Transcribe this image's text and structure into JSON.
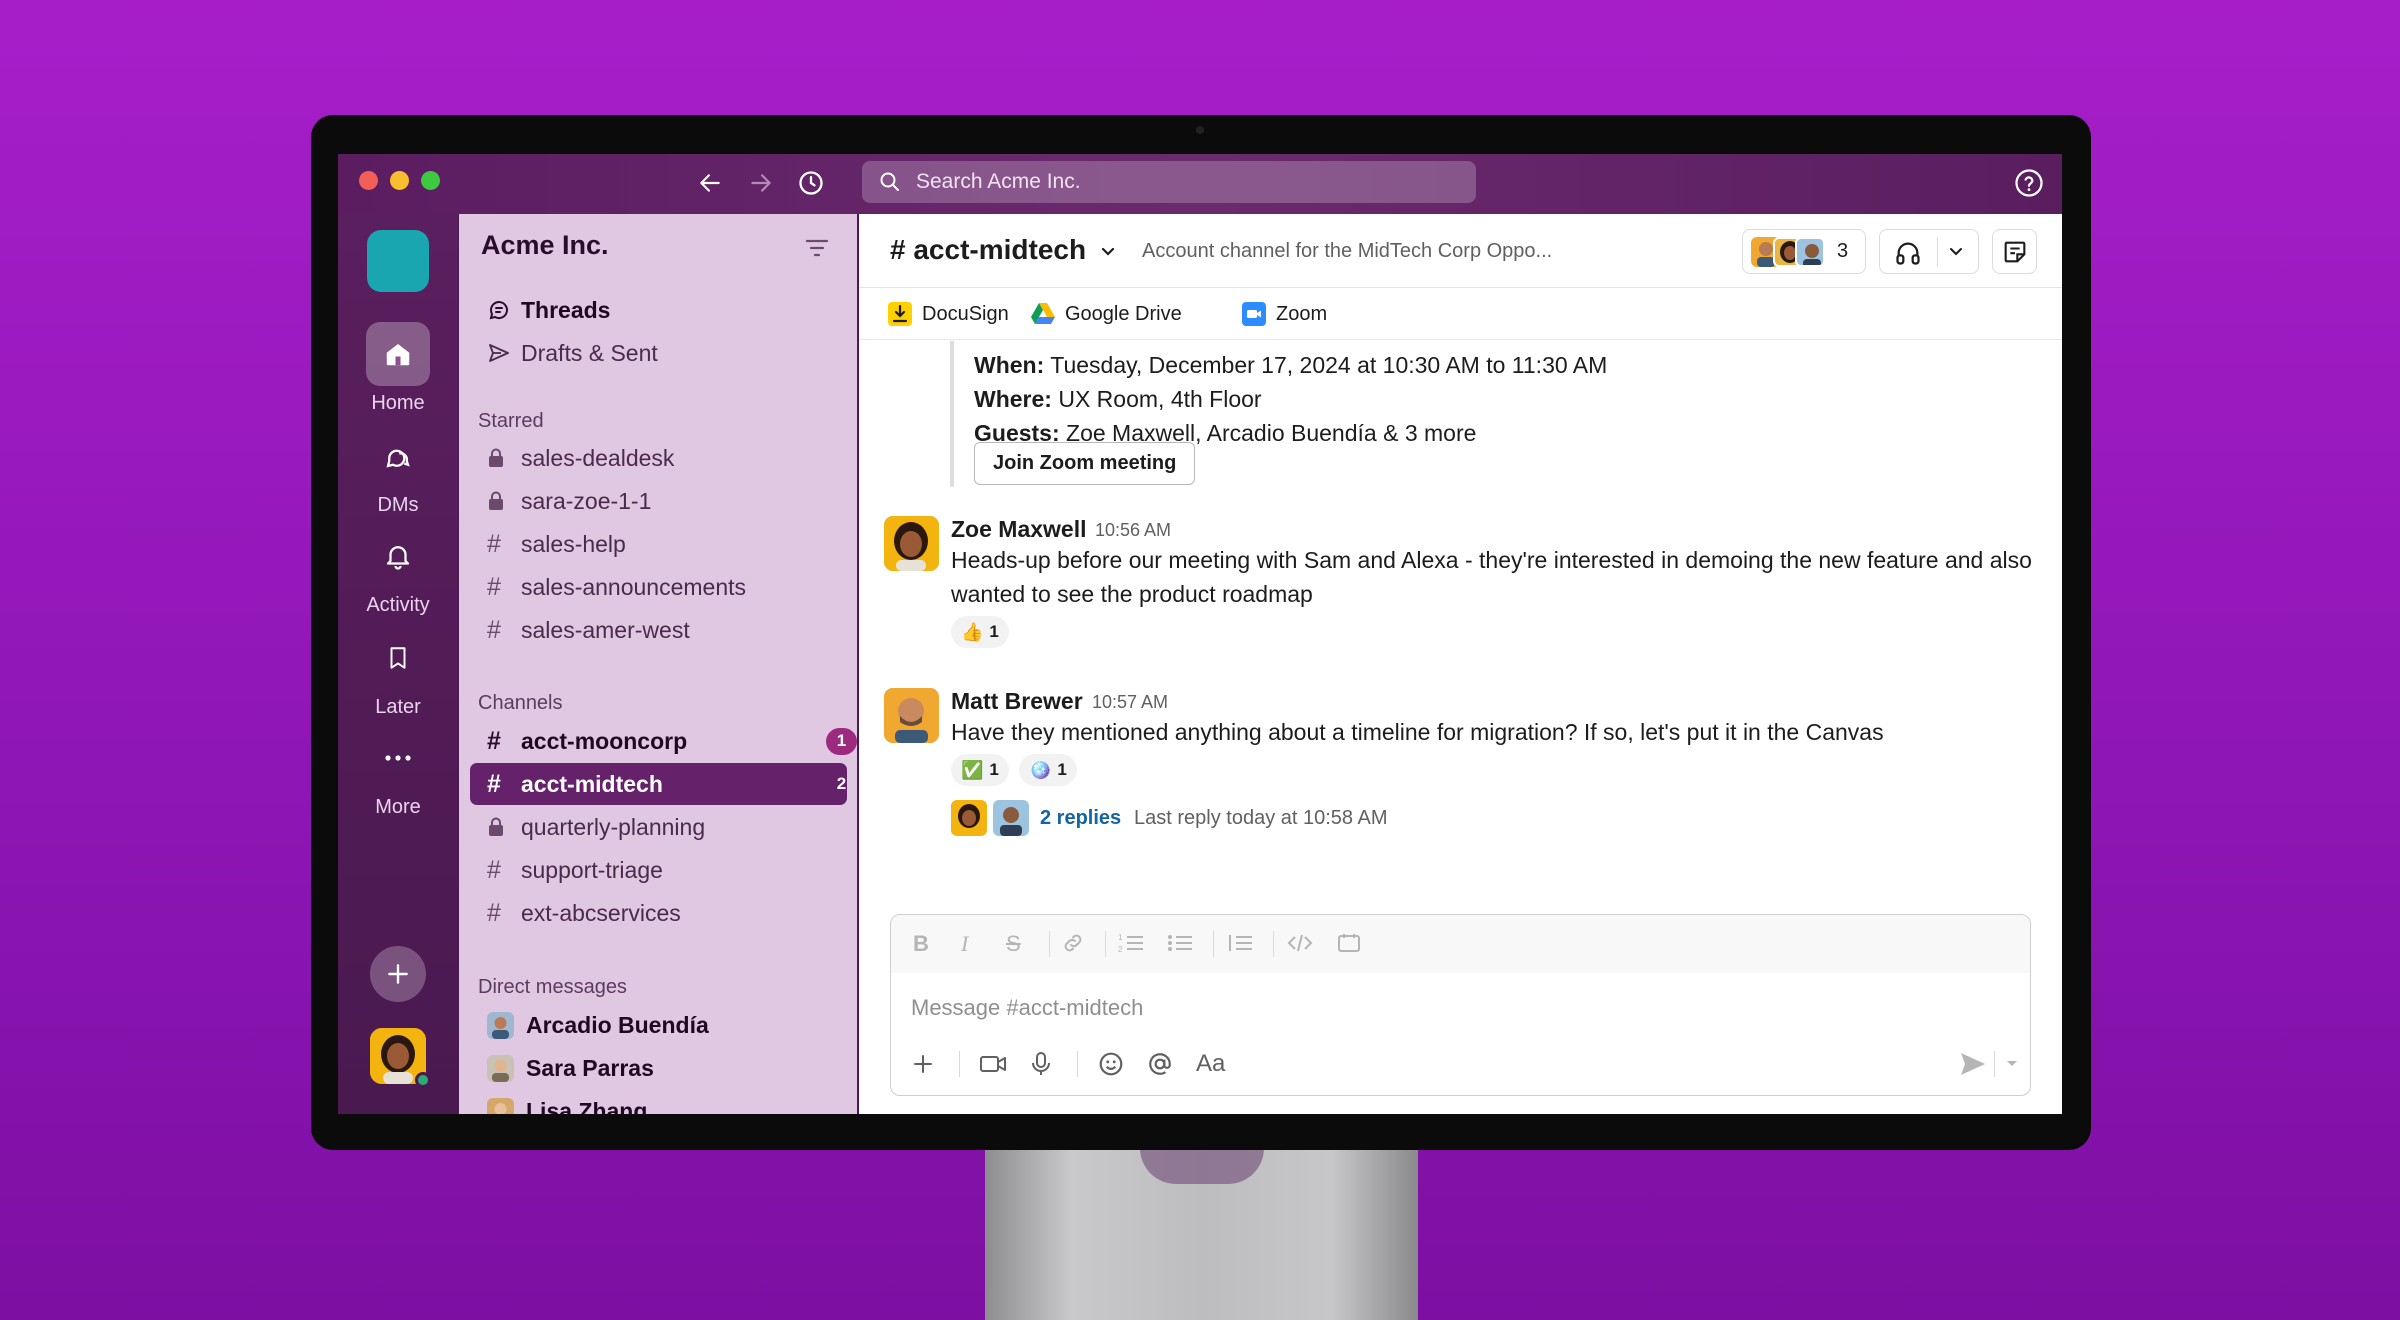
{
  "titlebar": {
    "search_placeholder": "Search Acme Inc."
  },
  "rail": {
    "items": [
      {
        "label": "Home",
        "icon": "home-icon"
      },
      {
        "label": "DMs",
        "icon": "dms-icon"
      },
      {
        "label": "Activity",
        "icon": "bell-icon"
      },
      {
        "label": "Later",
        "icon": "bookmark-icon"
      },
      {
        "label": "More",
        "icon": "ellipsis-icon"
      }
    ]
  },
  "sidebar": {
    "workspace_name": "Acme Inc.",
    "threads": "Threads",
    "drafts": "Drafts & Sent",
    "starred_title": "Starred",
    "starred": [
      "sales-dealdesk",
      "sara-zoe-1-1",
      "sales-help",
      "sales-announcements",
      "sales-amer-west"
    ],
    "channels_title": "Channels",
    "channels": [
      {
        "name": "acct-mooncorp",
        "badge": "1"
      },
      {
        "name": "acct-midtech",
        "badge": "2"
      },
      {
        "name": "quarterly-planning",
        "badge": ""
      },
      {
        "name": "support-triage",
        "badge": ""
      },
      {
        "name": "ext-abcservices",
        "badge": ""
      }
    ],
    "dm_title": "Direct messages",
    "dms": [
      "Arcadio Buendía",
      "Sara Parras",
      "Lisa Zhang"
    ]
  },
  "channel": {
    "name": "# acct-midtech",
    "description": "Account channel for the MidTech Corp Oppo...",
    "member_count": "3",
    "bookmarks": [
      "DocuSign",
      "Google Drive",
      "Zoom"
    ]
  },
  "event": {
    "when_label": "When:",
    "when_value": "Tuesday, December 17, 2024 at 10:30 AM to 11:30 AM",
    "where_label": "Where:",
    "where_value": "UX Room, 4th Floor",
    "guests_label": "Guests:",
    "guests_value": "Zoe Maxwell, Arcadio Buendía & 3 more",
    "join_button": "Join Zoom meeting"
  },
  "messages": [
    {
      "author": "Zoe Maxwell",
      "time": "10:56 AM",
      "text_line1": "Heads-up before our meeting with Sam and Alexa - they're interested in demoing the new feature and also",
      "text_line2": "wanted to see the product roadmap",
      "reactions": [
        {
          "emoji": "👍",
          "count": "1"
        }
      ]
    },
    {
      "author": "Matt Brewer",
      "time": "10:57 AM",
      "text": "Have they mentioned anything about a timeline for migration? If so, let's put it in the Canvas",
      "reactions": [
        {
          "emoji": "✅",
          "count": "1"
        },
        {
          "emoji": "🪩",
          "count": "1"
        }
      ],
      "replies": "2 replies",
      "last_reply": "Last reply today at 10:58 AM"
    }
  ],
  "composer": {
    "placeholder": "Message #acct-midtech"
  },
  "colors": {
    "background": "#a71ec9",
    "sidebar": "#e0c7e2",
    "active_channel": "#65226b",
    "link": "#1264a3"
  }
}
